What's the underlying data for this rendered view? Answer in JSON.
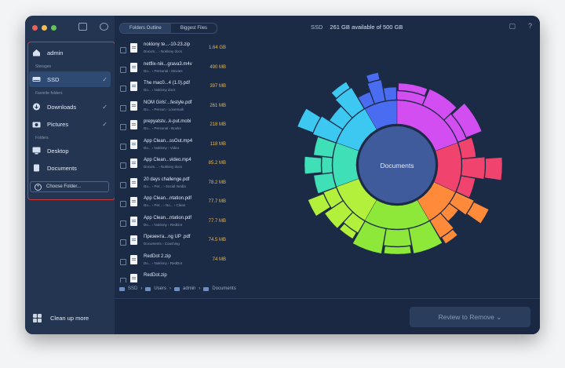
{
  "sidebar": {
    "items": [
      {
        "label": "admin",
        "icon": "home-icon"
      },
      {
        "section": "Storages"
      },
      {
        "label": "SSD",
        "icon": "drive-icon",
        "selected": true,
        "checked": true
      },
      {
        "section": "Favorite folders"
      },
      {
        "label": "Downloads",
        "icon": "download-icon",
        "checked": true
      },
      {
        "label": "Pictures",
        "icon": "camera-icon",
        "checked": true
      },
      {
        "section": "Folders"
      },
      {
        "label": "Desktop",
        "icon": "desktop-icon"
      },
      {
        "label": "Documents",
        "icon": "document-icon"
      }
    ],
    "choose_folder": "Choose Folder...",
    "cleanup": "Clean up more"
  },
  "toolbar": {
    "tabs": [
      "Folders Outline",
      "Biggest Files"
    ],
    "disk_label": "SSD",
    "disk_status": "261 GB available of 500 GB",
    "icons": [
      "chat-icon",
      "help-icon"
    ],
    "help_glyph": "?",
    "chat_glyph": "▢"
  },
  "files": [
    {
      "name": "noklony te...-10-23.zip",
      "path": "Docum... › Noklony docs",
      "size": "1.64 GB"
    },
    {
      "name": "netflix-nik...grava3.m4v",
      "path": "Do... › Personal › Movies",
      "size": "490 MB"
    },
    {
      "name": "The mac0...4 (1.0).pdf",
      "path": "Do... › Noklony docs",
      "size": "397 MB"
    },
    {
      "name": "NOM Girls'...festyle.pdf",
      "path": "Do... › Person › Lovemark",
      "size": "261 MB"
    },
    {
      "name": "prepyatstv...k-put.mobi",
      "path": "Do... › Personal › Books",
      "size": "218 MB"
    },
    {
      "name": "App Clean...ssOut.mp4",
      "path": "Do... › Noklony › Video",
      "size": "118 MB"
    },
    {
      "name": "App Clean...video.mp4",
      "path": "Docum... › Noklony docs",
      "size": "85.2 MB"
    },
    {
      "name": "20 days challenge.pdf",
      "path": "Do... › Per... › Social media",
      "size": "78.2 MB"
    },
    {
      "name": "App Clean...ntation.pdf",
      "path": "Do... › Per... › No... › Clean",
      "size": "77.7 MB"
    },
    {
      "name": "App Clean...ntation.pdf",
      "path": "Do... › Noklony › RedDot",
      "size": "77.7 MB"
    },
    {
      "name": "Презента...ng UP .pdf",
      "path": "Documents › Coaching",
      "size": "74.5 MB"
    },
    {
      "name": "RedDot 2.zip",
      "path": "Do... › Noklony › RedDot",
      "size": "74 MB"
    },
    {
      "name": "RedDot.zip",
      "path": "",
      "size": ""
    }
  ],
  "breadcrumb": [
    "SSD",
    "Users",
    "admin",
    "Documents"
  ],
  "chart": {
    "center_label": "Documents"
  },
  "review_button": "Review to Remove ⌄"
}
